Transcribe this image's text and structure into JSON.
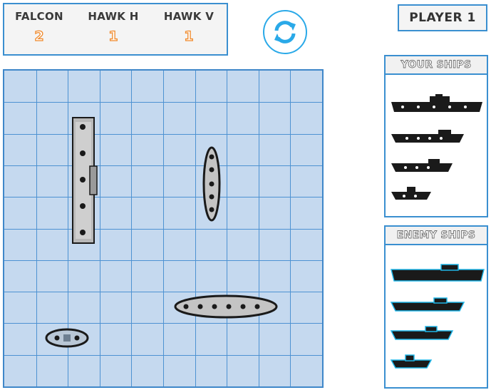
{
  "weapons": [
    {
      "name": "FALCON",
      "count": "2"
    },
    {
      "name": "HAWK H",
      "count": "1"
    },
    {
      "name": "HAWK V",
      "count": "1"
    }
  ],
  "rotate_icon": "rotate-arrows-icon",
  "player_label": "PLAYER 1",
  "board": {
    "columns": 10,
    "rows": 10,
    "ships": [
      {
        "name": "aircraft-carrier",
        "orientation": "vertical",
        "length": 4
      },
      {
        "name": "patrol-ship",
        "orientation": "vertical",
        "length": 2
      },
      {
        "name": "battleship",
        "orientation": "horizontal",
        "length": 3
      },
      {
        "name": "submarine",
        "orientation": "horizontal",
        "length": 1
      }
    ]
  },
  "your_ships_title": "YOUR SHIPS",
  "enemy_ships_title": "ENEMY SHIPS",
  "colors": {
    "accent": "#3a8fd0",
    "board_fill": "#c5d9ef",
    "counter": "#f08a2c",
    "rotate": "#2aa9e8",
    "enemy_outline": "#1fb6e8"
  }
}
